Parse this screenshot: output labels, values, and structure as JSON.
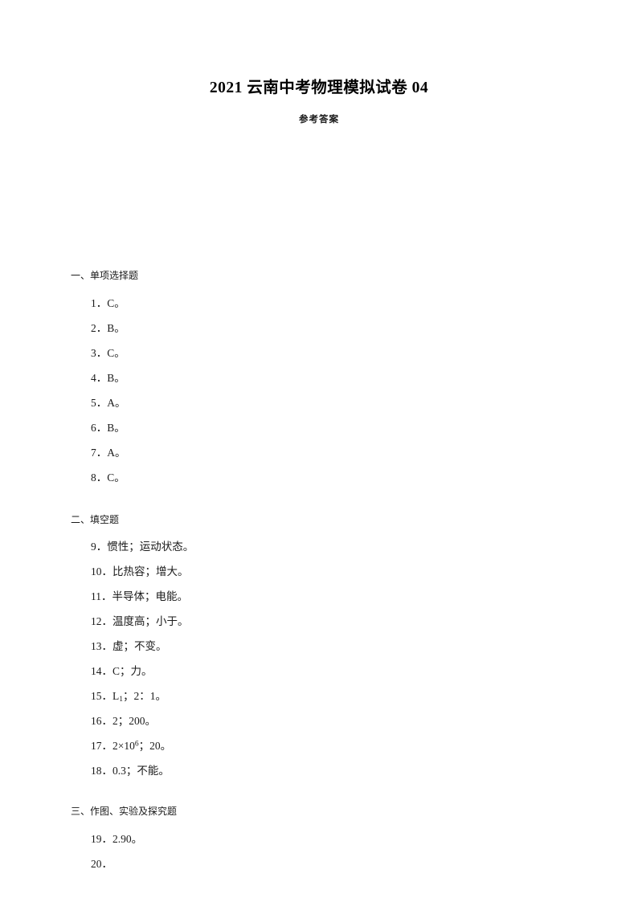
{
  "document": {
    "title": "2021 云南中考物理模拟试卷 04",
    "subtitle": "参考答案"
  },
  "sections": [
    {
      "heading": "一、单项选择题",
      "items": [
        {
          "number": "1．",
          "answer": "C。"
        },
        {
          "number": "2．",
          "answer": "B。"
        },
        {
          "number": "3．",
          "answer": "C。"
        },
        {
          "number": "4．",
          "answer": "B。"
        },
        {
          "number": "5．",
          "answer": "A。"
        },
        {
          "number": "6．",
          "answer": "B。"
        },
        {
          "number": "7．",
          "answer": "A。"
        },
        {
          "number": "8．",
          "answer": "C。"
        }
      ]
    },
    {
      "heading": "二、填空题",
      "items": [
        {
          "number": "9．",
          "answer": "惯性；运动状态。"
        },
        {
          "number": "10．",
          "answer": "比热容；增大。"
        },
        {
          "number": "11．",
          "answer": "半导体；电能。"
        },
        {
          "number": "12．",
          "answer": "温度高；小于。"
        },
        {
          "number": "13．",
          "answer": "虚；不变。"
        },
        {
          "number": "14．",
          "answer": "C；力。"
        },
        {
          "number": "15．",
          "answer_pre": "L",
          "answer_sub": "1",
          "answer_post": "；2：1。"
        },
        {
          "number": "16．",
          "answer": "2；200。"
        },
        {
          "number": "17．",
          "answer_pre": "2×10",
          "answer_sup": "6",
          "answer_post": "；20。"
        },
        {
          "number": "18．",
          "answer": "0.3；不能。"
        }
      ]
    },
    {
      "heading": "三、作图、实验及探究题",
      "items": [
        {
          "number": "19．",
          "answer": "2.90。"
        },
        {
          "number": "20．",
          "answer": ""
        }
      ]
    }
  ]
}
